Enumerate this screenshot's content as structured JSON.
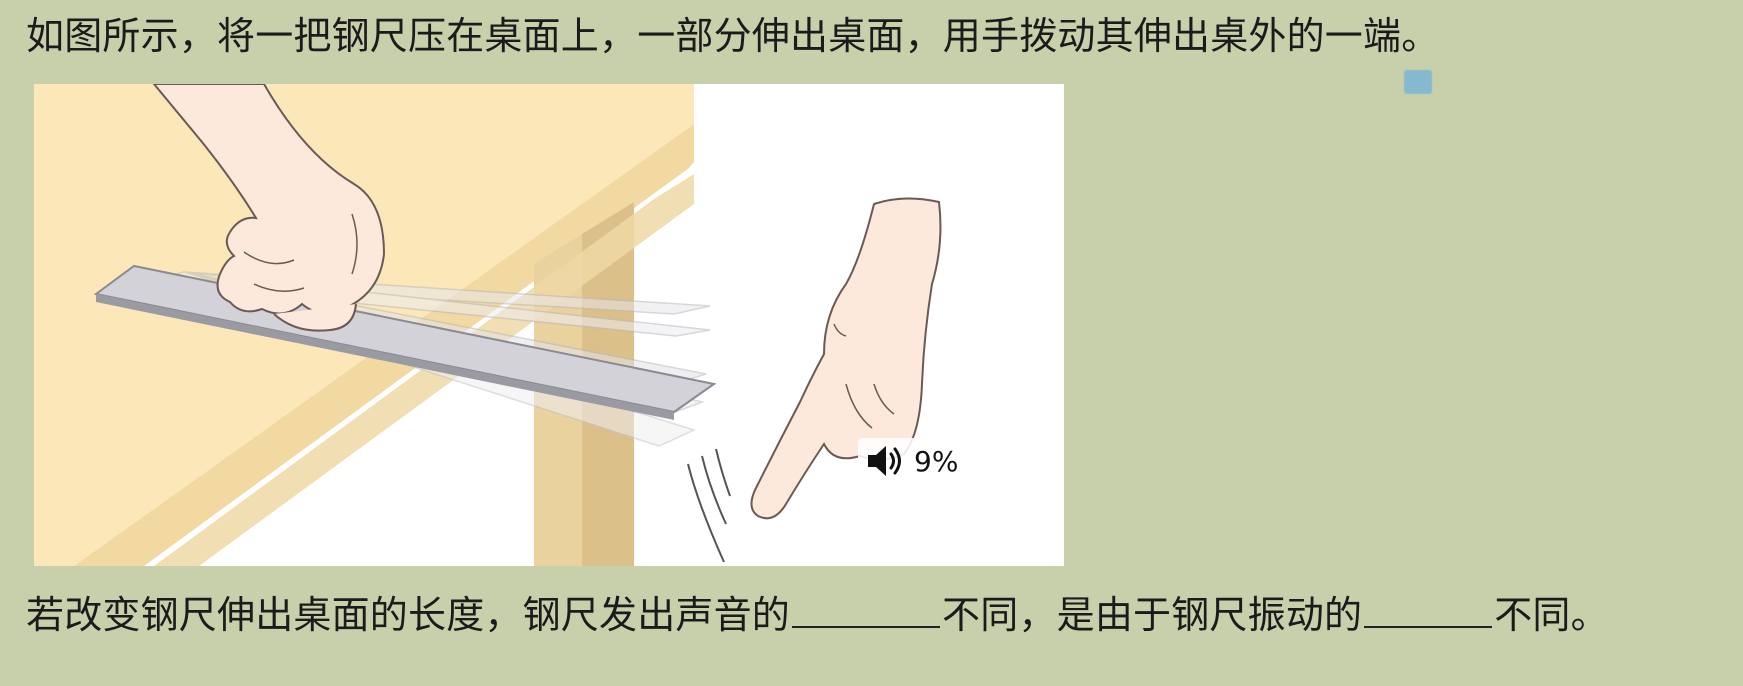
{
  "question": {
    "line1": "如图所示，将一把钢尺压在桌面上，一部分伸出桌面，用手拨动其伸出桌外的一端。",
    "line2_part1": "若改变钢尺伸出桌面的长度，钢尺发出声音的",
    "line2_part2": "不同，是由于钢尺振动的",
    "line2_part3": "不同。"
  },
  "volume_overlay": {
    "icon": "speaker-icon",
    "percent_text": "9%",
    "level": 0.09
  },
  "colors": {
    "background": "#c7d0ab",
    "table_top": "#fbe6b7",
    "table_leg": "#e3cb9a",
    "skin": "#fce8dc",
    "ruler": "#cfcfd4",
    "cursor": "#7ab6d7"
  }
}
